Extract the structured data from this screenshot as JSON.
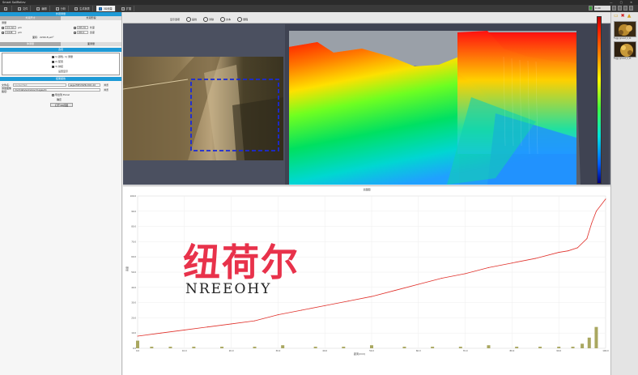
{
  "window": {
    "title": "Smart SoilReliev",
    "controls": "— ▢ ✕"
  },
  "toolbar": {
    "items": [
      {
        "label": ""
      },
      {
        "label": "文件"
      },
      {
        "label": "编辑"
      },
      {
        "label": "分析"
      },
      {
        "label": "生成报表"
      },
      {
        "label": "3D测量"
      },
      {
        "label": "扩展"
      }
    ],
    "active_index": 5,
    "value_box": "0.00"
  },
  "left": {
    "section1": "外观测量",
    "tabs": [
      "外观尺寸",
      "外观形貌"
    ],
    "row_label": "测量",
    "field_rows": [
      {
        "a": "0.5 mm",
        "a_unit": "μm",
        "b": "255.70",
        "b_unit": "长度"
      },
      {
        "a": "0.048",
        "a_unit": "μm",
        "b": "200.2",
        "b_unit": "宽度"
      },
      {
        "a": "",
        "a_unit": "",
        "b": "339.72",
        "b_unit": "高度"
      }
    ],
    "area_label": "面积:",
    "area_value": "2294.8 μm²",
    "tabs2": [
      "体测量",
      "面测量"
    ],
    "section2": "选项",
    "checks": [
      {
        "label": "1) 颜色, 1) 测量",
        "on": true
      },
      {
        "label": "2) 配置",
        "on": true
      },
      {
        "label": "3) 拼接",
        "on": true
      }
    ],
    "apply_label": "设置显示",
    "section3": "结果报告",
    "file_label": "文件名:",
    "file_placeholder": "ContentText",
    "file_value": "page.HRE.MLPR.2021.10",
    "browse_label": "浏览",
    "path_label": "测量图像路径:",
    "path_value": "/mnt/data/soilreliev/images/A1",
    "path_btn": "浏览",
    "export_chk": "导出到 Excel",
    "confirm": "确定",
    "open_btn": "打开3D视图"
  },
  "view": {
    "title": "",
    "tools": [
      {
        "icon": "pen-icon",
        "label": "画线"
      },
      {
        "icon": "ban-icon",
        "label": "清除"
      },
      {
        "icon": "text-icon",
        "label": "文本"
      },
      {
        "icon": "ruler-icon",
        "label": "量程"
      }
    ],
    "tools_prefix": "显示选项"
  },
  "right": {
    "thumbs": [
      {
        "caption": "Foggy ground_0_14"
      },
      {
        "caption": "Foggy ground_0_15"
      }
    ]
  },
  "chart_data": {
    "type": "bar",
    "title": "表面图",
    "xlabel": "距离(mm)",
    "ylabel": "高度",
    "ylim": [
      0,
      100
    ],
    "ytick_step": 10,
    "line": {
      "x": [
        0,
        5,
        10,
        15,
        20,
        25,
        30,
        35,
        40,
        45,
        50,
        55,
        60,
        65,
        70,
        75,
        80,
        85,
        90,
        92,
        94,
        96,
        97,
        98,
        100
      ],
      "y": [
        8,
        10,
        12,
        14,
        16,
        18,
        22,
        25,
        28,
        31,
        34,
        38,
        42,
        46,
        49,
        53,
        56,
        59,
        63,
        64,
        66,
        72,
        82,
        90,
        98
      ]
    },
    "bars": {
      "x": [
        0,
        3,
        7,
        12,
        18,
        25,
        31,
        38,
        44,
        50,
        57,
        63,
        69,
        75,
        81,
        86,
        90,
        93,
        95,
        96.5,
        98
      ],
      "y": [
        5,
        1,
        1,
        1,
        1,
        1,
        2,
        1,
        1,
        2,
        1,
        1,
        1,
        2,
        1,
        1,
        1,
        1,
        3,
        7,
        14
      ]
    },
    "xlim": [
      0,
      100
    ],
    "xticks": [
      "0.0",
      "10.0",
      "20.0",
      "30.0",
      "40.0",
      "50.0",
      "60.0",
      "70.0",
      "80.0",
      "90.0",
      "100.0"
    ],
    "line_color": "#e0302a",
    "bar_color": "#a9a760"
  },
  "watermark": {
    "cn": "纽荷尔",
    "en": "NREEOHY"
  }
}
